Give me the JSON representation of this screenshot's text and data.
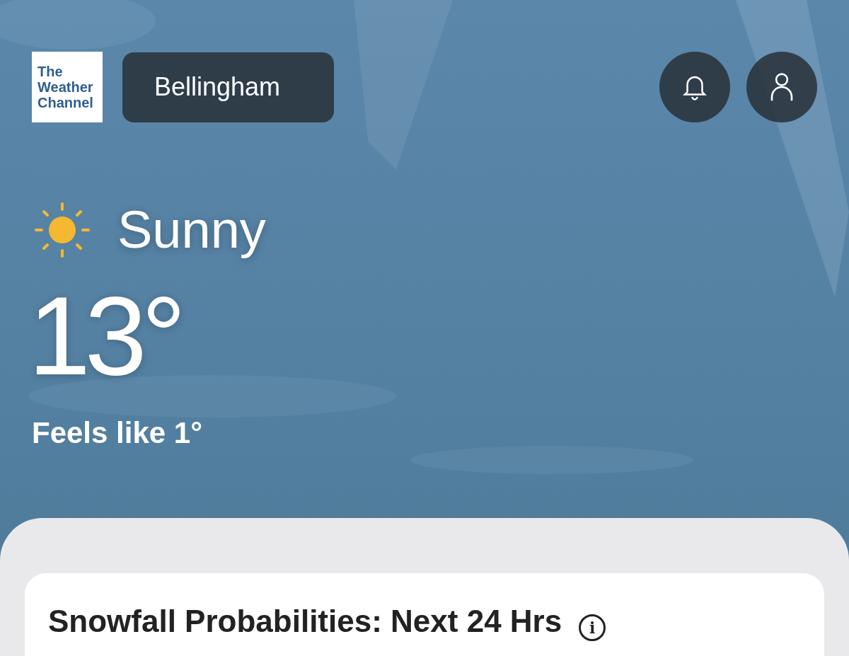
{
  "logo": {
    "lines": [
      "The",
      "Weather",
      "Channel"
    ]
  },
  "location": "Bellingham",
  "current": {
    "condition": "Sunny",
    "temperature": "13°",
    "feels_like": "Feels like 1°"
  },
  "card": {
    "title": "Snowfall Probabilities: Next 24 Hrs",
    "info_icon": "i"
  }
}
